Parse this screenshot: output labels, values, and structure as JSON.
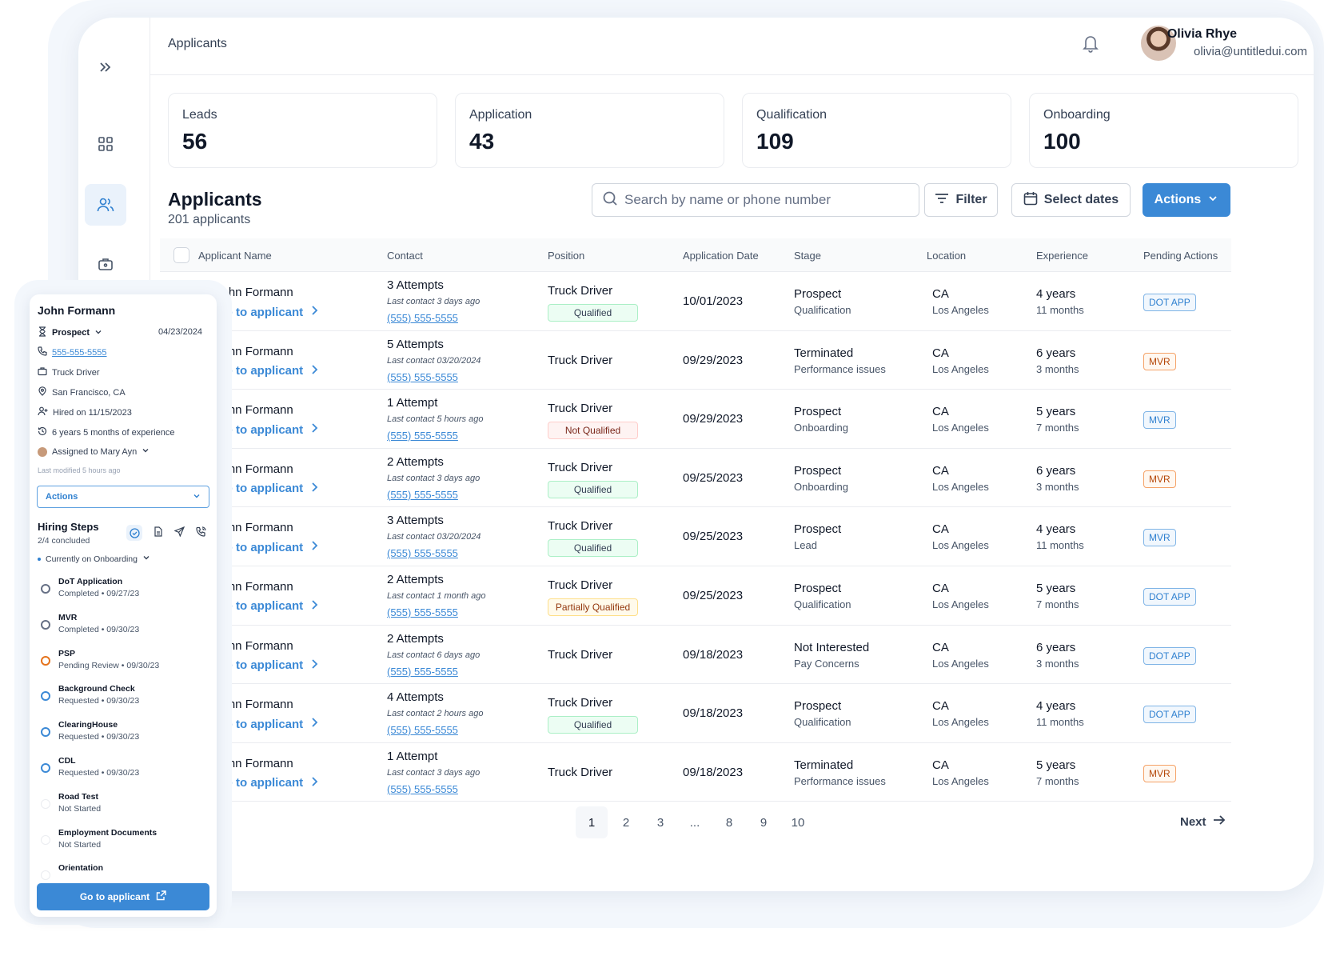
{
  "header": {
    "breadcrumb": "Applicants",
    "user_name": "Olivia Rhye",
    "user_email": "olivia@untitledui.com"
  },
  "stats": [
    {
      "label": "Leads",
      "value": "56"
    },
    {
      "label": "Application",
      "value": "43"
    },
    {
      "label": "Qualification",
      "value": "109"
    },
    {
      "label": "Onboarding",
      "value": "100"
    }
  ],
  "section": {
    "title": "Applicants",
    "subtitle": "201 applicants"
  },
  "toolbar": {
    "search_placeholder": "Search by name or phone number",
    "filter_label": "Filter",
    "dates_label": "Select dates",
    "actions_label": "Actions"
  },
  "table": {
    "headers": [
      "Applicant Name",
      "Contact",
      "Position",
      "Application Date",
      "Stage",
      "Location",
      "Experience",
      "Pending Actions"
    ],
    "rows": [
      {
        "name": "John Formann",
        "goto": "Go to applicant",
        "attempts": "3 Attempts",
        "last": "Last contact 3 days ago",
        "phone": "(555) 555-5555",
        "position": "Truck Driver",
        "status": "Qualified",
        "status_type": "q",
        "date": "10/01/2023",
        "stage": "Prospect",
        "stage_sub": "Qualification",
        "state": "CA",
        "city": "Los Angeles",
        "exp": "4 years",
        "exp_sub": "11 months",
        "pending": "DOT APP",
        "pending_color": "blue"
      },
      {
        "name": "John Formann",
        "goto": "Go to applicant",
        "attempts": "5 Attempts",
        "last": "Last contact 03/20/2024",
        "phone": "(555) 555-5555",
        "position": "Truck Driver",
        "status": "",
        "status_type": "",
        "date": "09/29/2023",
        "stage": "Terminated",
        "stage_sub": "Performance issues",
        "state": "CA",
        "city": "Los Angeles",
        "exp": "6 years",
        "exp_sub": "3 months",
        "pending": "MVR",
        "pending_color": "orange"
      },
      {
        "name": "John Formann",
        "goto": "Go to applicant",
        "attempts": "1 Attempt",
        "last": "Last contact 5 hours ago",
        "phone": "(555) 555-5555",
        "position": "Truck Driver",
        "status": "Not Qualified",
        "status_type": "nq",
        "date": "09/29/2023",
        "stage": "Prospect",
        "stage_sub": "Onboarding",
        "state": "CA",
        "city": "Los Angeles",
        "exp": "5 years",
        "exp_sub": "7 months",
        "pending": "MVR",
        "pending_color": "blue"
      },
      {
        "name": "John Formann",
        "goto": "Go to applicant",
        "attempts": "2 Attempts",
        "last": "Last contact 3 days ago",
        "phone": "(555) 555-5555",
        "position": "Truck Driver",
        "status": "Qualified",
        "status_type": "q",
        "date": "09/25/2023",
        "stage": "Prospect",
        "stage_sub": "Onboarding",
        "state": "CA",
        "city": "Los Angeles",
        "exp": "6 years",
        "exp_sub": "3 months",
        "pending": "MVR",
        "pending_color": "orange"
      },
      {
        "name": "John Formann",
        "goto": "Go to applicant",
        "attempts": "3 Attempts",
        "last": "Last contact 03/20/2024",
        "phone": "(555) 555-5555",
        "position": "Truck Driver",
        "status": "Qualified",
        "status_type": "q",
        "date": "09/25/2023",
        "stage": "Prospect",
        "stage_sub": "Lead",
        "state": "CA",
        "city": "Los Angeles",
        "exp": "4 years",
        "exp_sub": "11 months",
        "pending": "MVR",
        "pending_color": "blue"
      },
      {
        "name": "John Formann",
        "goto": "Go to applicant",
        "attempts": "2 Attempts",
        "last": "Last contact 1 month ago",
        "phone": "(555) 555-5555",
        "position": "Truck Driver",
        "status": "Partially Qualified",
        "status_type": "pq",
        "date": "09/25/2023",
        "stage": "Prospect",
        "stage_sub": "Qualification",
        "state": "CA",
        "city": "Los Angeles",
        "exp": "5 years",
        "exp_sub": "7 months",
        "pending": "DOT APP",
        "pending_color": "blue"
      },
      {
        "name": "John Formann",
        "goto": "Go to applicant",
        "attempts": "2 Attempts",
        "last": "Last contact 6 days ago",
        "phone": "(555) 555-5555",
        "position": "Truck Driver",
        "status": "",
        "status_type": "",
        "date": "09/18/2023",
        "stage": "Not Interested",
        "stage_sub": "Pay Concerns",
        "state": "CA",
        "city": "Los Angeles",
        "exp": "6 years",
        "exp_sub": "3 months",
        "pending": "DOT APP",
        "pending_color": "blue"
      },
      {
        "name": "John Formann",
        "goto": "Go to applicant",
        "attempts": "4 Attempts",
        "last": "Last contact 2 hours ago",
        "phone": "(555) 555-5555",
        "position": "Truck Driver",
        "status": "Qualified",
        "status_type": "q",
        "date": "09/18/2023",
        "stage": "Prospect",
        "stage_sub": "Qualification",
        "state": "CA",
        "city": "Los Angeles",
        "exp": "4 years",
        "exp_sub": "11 months",
        "pending": "DOT APP",
        "pending_color": "blue"
      },
      {
        "name": "John Formann",
        "goto": "Go to applicant",
        "attempts": "1 Attempt",
        "last": "Last contact 3 days ago",
        "phone": "(555) 555-5555",
        "position": "Truck Driver",
        "status": "",
        "status_type": "",
        "date": "09/18/2023",
        "stage": "Terminated",
        "stage_sub": "Performance issues",
        "state": "CA",
        "city": "Los Angeles",
        "exp": "5 years",
        "exp_sub": "7 months",
        "pending": "MVR",
        "pending_color": "orange"
      }
    ]
  },
  "pagination": {
    "pages": [
      "1",
      "2",
      "3",
      "...",
      "8",
      "9",
      "10"
    ],
    "current": "1",
    "next_label": "Next"
  },
  "side_card": {
    "name": "John Formann",
    "stage": "Prospect",
    "date": "04/23/2024",
    "phone": "555-555-5555",
    "position": "Truck Driver",
    "location": "San Francisco, CA",
    "hired": "Hired on 11/15/2023",
    "experience": "6 years 5 months of experience",
    "assigned": "Assigned to Mary Ayn",
    "modified": "Last modified 5 hours ago",
    "actions_label": "Actions",
    "hiring_title": "Hiring Steps",
    "hiring_sub": "2/4 concluded",
    "current": "Currently on Onboarding",
    "steps": [
      {
        "title": "DoT Application",
        "sub": "Completed • 09/27/23",
        "state": "done"
      },
      {
        "title": "MVR",
        "sub": "Completed • 09/30/23",
        "state": "done"
      },
      {
        "title": "PSP",
        "sub": "Pending Review • 09/30/23",
        "state": "pend"
      },
      {
        "title": "Background Check",
        "sub": "Requested • 09/30/23",
        "state": "req"
      },
      {
        "title": "ClearingHouse",
        "sub": "Requested • 09/30/23",
        "state": "req"
      },
      {
        "title": "CDL",
        "sub": "Requested • 09/30/23",
        "state": "req"
      },
      {
        "title": "Road Test",
        "sub": "Not Started",
        "state": "ns"
      },
      {
        "title": "Employment Documents",
        "sub": "Not Started",
        "state": "ns"
      },
      {
        "title": "Orientation",
        "sub": "",
        "state": "ns"
      }
    ],
    "go_label": "Go to applicant"
  },
  "colors": {
    "accent": "#3b89d6",
    "qualified_bg": "#ecfdf3",
    "not_qualified_bg": "#fef3f2",
    "partial_bg": "#fffaeb"
  }
}
